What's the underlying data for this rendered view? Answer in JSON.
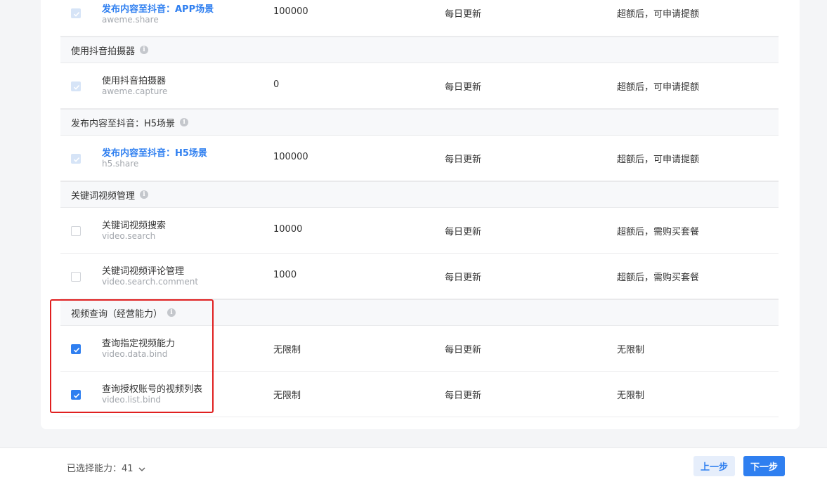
{
  "groups": [
    {
      "header": null,
      "rows": [
        {
          "name": "发布内容至抖音：APP场景",
          "code": "aweme.share",
          "quota": "100000",
          "freq": "每日更新",
          "policy": "超额后，可申请提额",
          "state": "disabled-checked",
          "link": true
        }
      ]
    },
    {
      "header": "使用抖音拍摄器",
      "rows": [
        {
          "name": "使用抖音拍摄器",
          "code": "aweme.capture",
          "quota": "0",
          "freq": "每日更新",
          "policy": "超额后，可申请提额",
          "state": "disabled-checked",
          "link": false
        }
      ]
    },
    {
      "header": "发布内容至抖音：H5场景",
      "rows": [
        {
          "name": "发布内容至抖音：H5场景",
          "code": "h5.share",
          "quota": "100000",
          "freq": "每日更新",
          "policy": "超额后，可申请提额",
          "state": "disabled-checked",
          "link": true
        }
      ]
    },
    {
      "header": "关键词视频管理",
      "rows": [
        {
          "name": "关键词视频搜索",
          "code": "video.search",
          "quota": "10000",
          "freq": "每日更新",
          "policy": "超额后，需购买套餐",
          "state": "unchecked",
          "link": false
        },
        {
          "name": "关键词视频评论管理",
          "code": "video.search.comment",
          "quota": "1000",
          "freq": "每日更新",
          "policy": "超额后，需购买套餐",
          "state": "unchecked",
          "link": false
        }
      ]
    },
    {
      "header": "视频查询（经营能力）",
      "rows": [
        {
          "name": "查询指定视频能力",
          "code": "video.data.bind",
          "quota": "无限制",
          "freq": "每日更新",
          "policy": "无限制",
          "state": "checked",
          "link": false
        },
        {
          "name": "查询授权账号的视频列表",
          "code": "video.list.bind",
          "quota": "无限制",
          "freq": "每日更新",
          "policy": "无限制",
          "state": "checked",
          "link": false
        }
      ]
    }
  ],
  "footer": {
    "selected_label": "已选择能力：41",
    "prev_label": "上一步",
    "next_label": "下一步"
  },
  "colors": {
    "accent": "#2f7ff0",
    "highlight": "#e02020"
  },
  "icons": {
    "group_info": "info-icon",
    "checkbox_mark": "checkmark-icon",
    "expand": "chevron-down-icon"
  }
}
